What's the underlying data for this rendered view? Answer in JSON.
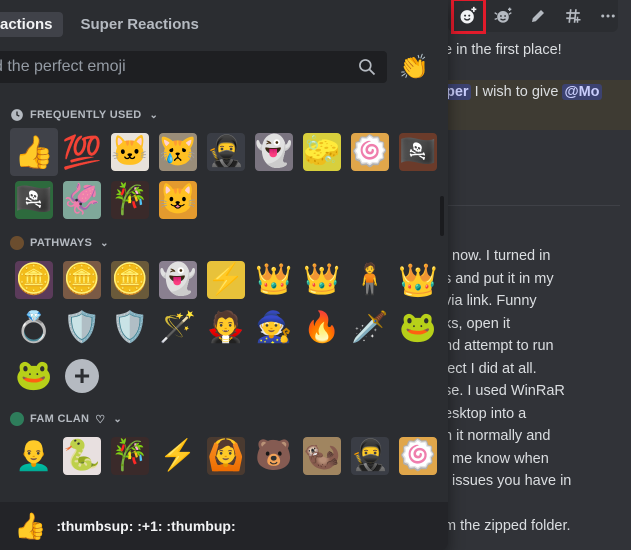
{
  "picker": {
    "tabs": [
      {
        "label": "Reactions",
        "visible_text": "actions",
        "selected": true
      },
      {
        "label": "Super Reactions",
        "selected": false
      }
    ],
    "search": {
      "placeholder": "Find the perfect emoji",
      "visible_placeholder": "d the perfect emoji",
      "value": ""
    },
    "diversity_emoji": "👏",
    "sections": [
      {
        "title": "FREQUENTLY USED",
        "icon": "clock-icon",
        "emojis": [
          {
            "name": "thumbsup",
            "glyph": "👍",
            "kind": "unicode"
          },
          {
            "name": "100",
            "glyph": "💯",
            "kind": "unicode"
          },
          {
            "name": "custom-cat-sad",
            "glyph": "🐱",
            "kind": "custom",
            "bg": "#e8e2da"
          },
          {
            "name": "custom-cat-crying",
            "glyph": "😿",
            "kind": "custom",
            "bg": "#9a8d79"
          },
          {
            "name": "custom-anime-itachi",
            "glyph": "🥷",
            "kind": "custom",
            "bg": "#3a3d45"
          },
          {
            "name": "custom-anime-horror",
            "glyph": "👻",
            "kind": "custom",
            "bg": "#7a7480"
          },
          {
            "name": "custom-spongebob",
            "glyph": "🧽",
            "kind": "custom",
            "bg": "#d8cf3c"
          },
          {
            "name": "custom-naruto",
            "glyph": "🍥",
            "kind": "custom",
            "bg": "#e0a64a"
          },
          {
            "name": "custom-luffy-thumbs",
            "glyph": "🏴‍☠️",
            "kind": "custom",
            "bg": "#6b3b2a"
          },
          {
            "name": "custom-luffy",
            "glyph": "🏴‍☠️",
            "kind": "custom",
            "bg": "#2d6a3d"
          },
          {
            "name": "custom-squidward",
            "glyph": "🦑",
            "kind": "custom",
            "bg": "#7fa89a"
          },
          {
            "name": "custom-nezuko",
            "glyph": "🎋",
            "kind": "custom",
            "bg": "#3a2a2a"
          },
          {
            "name": "custom-cat-yes",
            "glyph": "😺",
            "kind": "custom",
            "bg": "#e39a2e"
          }
        ]
      },
      {
        "title": "PATHWAYS",
        "icon": "server-icon",
        "emojis": [
          {
            "name": "custom-coin-purple",
            "glyph": "🪙",
            "kind": "custom",
            "bg": "#5b3b5a"
          },
          {
            "name": "custom-coin-bronze",
            "glyph": "🪙",
            "kind": "custom",
            "bg": "#7a5a45"
          },
          {
            "name": "custom-coin-gold",
            "glyph": "🪙",
            "kind": "custom",
            "bg": "#6a5a3a"
          },
          {
            "name": "custom-ghost-horror",
            "glyph": "👻",
            "kind": "custom",
            "bg": "#8a8090"
          },
          {
            "name": "custom-pikachu-shocked",
            "glyph": "⚡",
            "kind": "custom",
            "bg": "#e8c23a"
          },
          {
            "name": "custom-crown-gold",
            "glyph": "👑",
            "kind": "custom",
            "bg": "transparent"
          },
          {
            "name": "custom-crown-red",
            "glyph": "👑",
            "kind": "custom",
            "bg": "transparent"
          },
          {
            "name": "custom-stretch-man",
            "glyph": "🧍",
            "kind": "custom",
            "bg": "transparent"
          },
          {
            "name": "crown",
            "glyph": "👑",
            "kind": "unicode"
          },
          {
            "name": "custom-one-ring",
            "glyph": "💍",
            "kind": "custom",
            "bg": "transparent"
          },
          {
            "name": "custom-hylian-shield",
            "glyph": "🛡️",
            "kind": "custom",
            "bg": "transparent"
          },
          {
            "name": "custom-gold-shield",
            "glyph": "🛡️",
            "kind": "custom",
            "bg": "transparent"
          },
          {
            "name": "custom-staff-dark",
            "glyph": "🪄",
            "kind": "custom",
            "bg": "transparent"
          },
          {
            "name": "custom-figure-red",
            "glyph": "🧛",
            "kind": "custom",
            "bg": "transparent"
          },
          {
            "name": "custom-wizard",
            "glyph": "🧙",
            "kind": "custom",
            "bg": "transparent"
          },
          {
            "name": "custom-staff-fire",
            "glyph": "🔥",
            "kind": "custom",
            "bg": "transparent"
          },
          {
            "name": "custom-wand",
            "glyph": "🗡️",
            "kind": "custom",
            "bg": "transparent"
          },
          {
            "name": "custom-pepe-frog",
            "glyph": "🐸",
            "kind": "custom",
            "bg": "transparent"
          },
          {
            "name": "custom-pepe-sad",
            "glyph": "🐸",
            "kind": "custom",
            "bg": "transparent"
          }
        ],
        "add_button": {
          "label": "+",
          "tooltip": "Add Emoji"
        }
      },
      {
        "title": "FAM CLAN",
        "title_suffix": "♡",
        "icon": "server-icon",
        "emojis": [
          {
            "name": "custom-bald-hero",
            "glyph": "👨‍🦲",
            "kind": "custom",
            "bg": "transparent"
          },
          {
            "name": "custom-orochimaru",
            "glyph": "🐍",
            "kind": "custom",
            "bg": "#e8e0e0"
          },
          {
            "name": "custom-nezuko-2",
            "glyph": "🎋",
            "kind": "custom",
            "bg": "#3a2a2a"
          },
          {
            "name": "custom-pikachu-2",
            "glyph": "⚡",
            "kind": "custom",
            "bg": "transparent"
          },
          {
            "name": "custom-man-hands",
            "glyph": "🙆",
            "kind": "custom",
            "bg": "#4a3a30"
          },
          {
            "name": "custom-bear-bear",
            "glyph": "🐻",
            "kind": "custom",
            "bg": "transparent"
          },
          {
            "name": "custom-otter",
            "glyph": "🦦",
            "kind": "custom",
            "bg": "#a08560"
          },
          {
            "name": "custom-itachi-2",
            "glyph": "🥷",
            "kind": "custom",
            "bg": "#3a3d45"
          },
          {
            "name": "custom-naruto-2",
            "glyph": "🍥",
            "kind": "custom",
            "bg": "#e0a64a"
          }
        ]
      }
    ],
    "footer": {
      "glyph": "👍",
      "text": ":thumbsup: :+1: :thumbup:"
    }
  },
  "message_toolbar": {
    "buttons": [
      {
        "name": "add-reaction",
        "label": "Add Reaction",
        "highlighted": true
      },
      {
        "name": "add-super-reaction",
        "label": "Add Super Reaction"
      },
      {
        "name": "edit",
        "label": "Edit"
      },
      {
        "name": "create-thread",
        "label": "Create Thread"
      },
      {
        "name": "more",
        "label": "More"
      }
    ]
  },
  "chat": {
    "line1": "e in the first place!",
    "line2_prefix": "per",
    "line2_text": " I wish to give ",
    "line2_mention": "@Mo",
    "lines": [
      "t now. I turned in",
      "s and put it in my",
      "via link. Funny",
      "ks, open it",
      "nd attempt to run",
      "ject I did at all.",
      "se. I used WinRaR",
      "esktop into a",
      "n it normally and",
      "t me know when",
      "t issues you have in",
      "",
      "m the zipped folder."
    ]
  }
}
